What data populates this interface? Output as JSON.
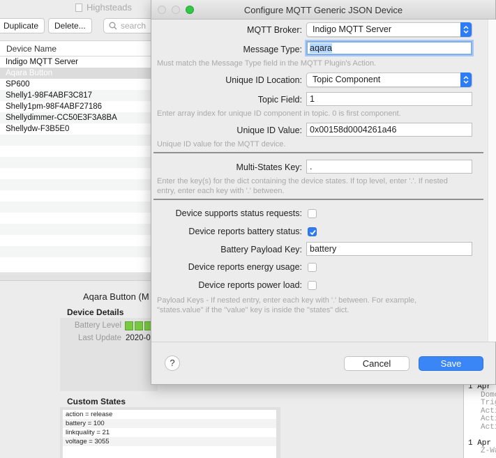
{
  "background": {
    "window_title": "Highsteads",
    "toolbar": {
      "duplicate_label": "Duplicate",
      "delete_label": "Delete...",
      "search_placeholder": "search"
    },
    "device_list": {
      "column_header": "Device Name",
      "rows": [
        "Indigo MQTT Server",
        "Aqara Button",
        "SP600",
        "Shelly1-98F4ABF3C817",
        "Shelly1pm-98F4ABF27186",
        "Shellydimmer-CC50E3F3A8BA",
        "Shellydw-F3B5E0"
      ],
      "selected_index": 1
    },
    "detail": {
      "title": "Aqara Button (M",
      "device_details_header": "Device Details",
      "battery_label": "Battery Level",
      "battery_segments": 3,
      "last_update_label": "Last Update",
      "last_update_value": "2020-0"
    },
    "custom_states": {
      "header": "Custom States",
      "rows": [
        "action = release",
        "battery = 100",
        "linkquality = 21",
        "voltage = 3055"
      ]
    },
    "log": {
      "lines": [
        {
          "text": "1 Apr",
          "kind": "date"
        },
        {
          "text": "Domo",
          "kind": "sub"
        },
        {
          "text": "Trig",
          "kind": "sub"
        },
        {
          "text": "Acti",
          "kind": "sub"
        },
        {
          "text": "Acti",
          "kind": "sub"
        },
        {
          "text": "Acti",
          "kind": "sub"
        },
        {
          "text": "",
          "kind": "sub"
        },
        {
          "text": "1 Apr",
          "kind": "date"
        },
        {
          "text": "Z-Wa",
          "kind": "sub"
        }
      ]
    }
  },
  "dialog": {
    "title": "Configure MQTT Generic JSON Device",
    "broker": {
      "label": "MQTT Broker:",
      "value": "Indigo MQTT Server"
    },
    "message_type": {
      "label": "Message Type:",
      "value": "aqara",
      "hint": "Must match the Message Type field in the MQTT Plugin's Action."
    },
    "unique_id_location": {
      "label": "Unique ID Location:",
      "value": "Topic Component"
    },
    "topic_field": {
      "label": "Topic Field:",
      "value": "1",
      "hint": "Enter array index for unique ID component in topic.  0 is first component."
    },
    "unique_id_value": {
      "label": "Unique ID Value:",
      "value": "0x00158d0004261a46",
      "hint": "Unique ID value for the MQTT device."
    },
    "multi_states_key": {
      "label": "Multi-States Key:",
      "value": ".",
      "hint_line1": "Enter the key(s) for the dict containing the device states.  If top level, enter '.'.  If nested",
      "hint_line2": "entry, enter each key with '.' between."
    },
    "status_requests": {
      "label": "Device supports status requests:",
      "checked": false
    },
    "battery_status": {
      "label": "Device reports battery status:",
      "checked": true
    },
    "battery_payload_key": {
      "label": "Battery Payload Key:",
      "value": "battery"
    },
    "energy_usage": {
      "label": "Device reports energy usage:",
      "checked": false
    },
    "power_load": {
      "label": "Device reports power load:",
      "checked": false
    },
    "payload_hint_line1": "Payload Keys - If nested entry, enter each key with '.' between.  For example,",
    "payload_hint_line2": "\"states.value\" if the \"value\" key is inside the \"states\" dict.",
    "help_label": "?",
    "cancel_label": "Cancel",
    "save_label": "Save"
  },
  "colors": {
    "accent": "#2d7cf6",
    "battery_green": "#7ac943"
  }
}
